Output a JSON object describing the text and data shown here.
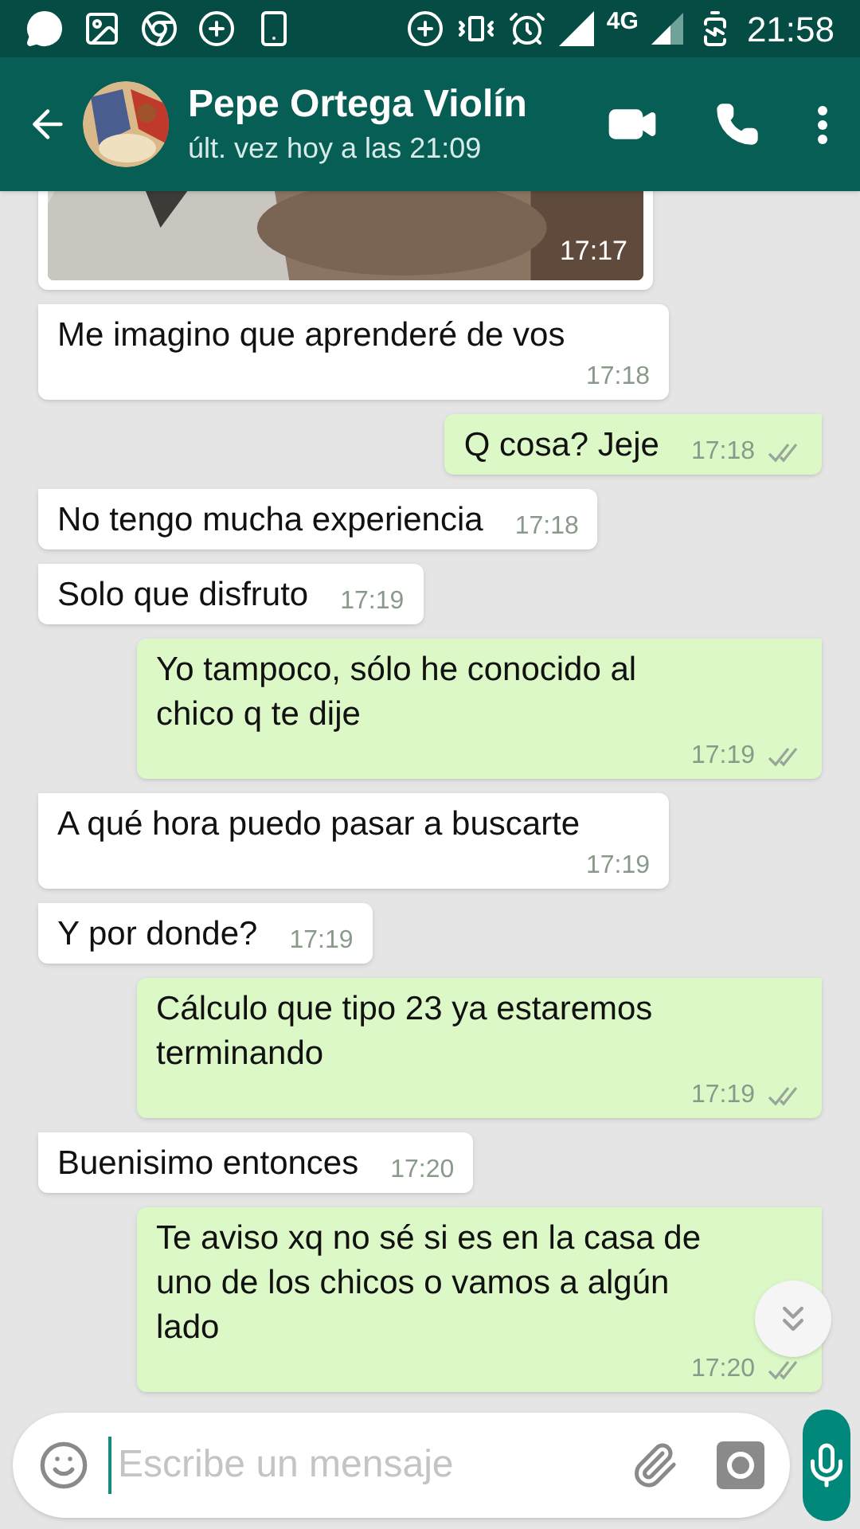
{
  "status_bar": {
    "network": "4G",
    "time": "21:58"
  },
  "header": {
    "contact_name": "Pepe Ortega Violín",
    "last_seen": "últ. vez hoy a las 21:09"
  },
  "messages": [
    {
      "kind": "photo_in",
      "time": "17:17"
    },
    {
      "kind": "in",
      "text": "Me  imagino que aprenderé de vos",
      "time": "17:18"
    },
    {
      "kind": "out",
      "text": "Q cosa? Jeje",
      "time": "17:18"
    },
    {
      "kind": "in",
      "text": "No tengo mucha experiencia",
      "time": "17:18"
    },
    {
      "kind": "in",
      "text": "Solo que disfruto",
      "time": "17:19"
    },
    {
      "kind": "out",
      "text": "Yo tampoco, sólo he conocido al chico q te dije",
      "time": "17:19"
    },
    {
      "kind": "in",
      "text": "A qué hora puedo pasar a buscarte",
      "time": "17:19"
    },
    {
      "kind": "in",
      "text": "Y por donde?",
      "time": "17:19"
    },
    {
      "kind": "out",
      "text": "Cálculo que tipo 23 ya estaremos terminando",
      "time": "17:19"
    },
    {
      "kind": "in",
      "text": "Buenisimo entonces",
      "time": "17:20"
    },
    {
      "kind": "out",
      "text": "Te aviso xq no sé si es en la casa de uno de los chicos o vamos a algún lado",
      "time": "17:20"
    }
  ],
  "composer": {
    "placeholder": "Escribe un mensaje"
  }
}
